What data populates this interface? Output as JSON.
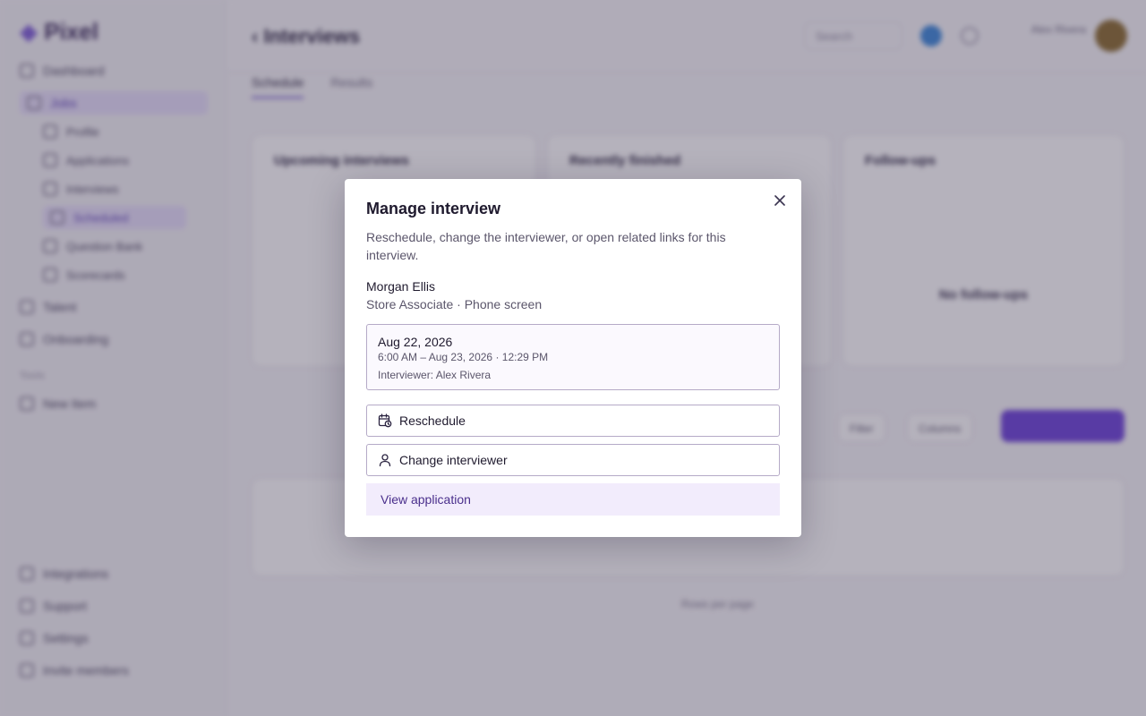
{
  "background": {
    "logo": "Pixel",
    "nav": [
      "Dashboard",
      "Jobs",
      "Profile",
      "Applications",
      "Interviews",
      "Scheduled",
      "Question Bank",
      "Scorecards",
      "Talent",
      "Onboarding"
    ],
    "nav_section": "Tools",
    "nav_extra": "New Item",
    "bottom_nav": [
      "Integrations",
      "Support",
      "Settings",
      "Invite members"
    ],
    "page_title": "Interviews",
    "search": "Search",
    "user": "Alex Rivera",
    "tabs": [
      "Schedule",
      "Results"
    ],
    "cards": [
      "Upcoming interviews",
      "Recently finished",
      "Follow-ups"
    ],
    "empty_title": "No follow-ups",
    "toolbar": [
      "Filter",
      "Columns"
    ],
    "pagination": "Rows per page"
  },
  "modal": {
    "title": "Manage interview",
    "description": "Reschedule, change the interviewer, or open related links for this interview.",
    "candidate_name": "Morgan Ellis",
    "candidate_role": "Store Associate · Phone screen",
    "schedule": {
      "date": "Aug 22, 2026",
      "range": "6:00 AM – Aug 23, 2026 · 12:29 PM",
      "interviewer": "Interviewer: Alex Rivera"
    },
    "actions": {
      "reschedule": "Reschedule",
      "change_interviewer": "Change interviewer",
      "view_application": "View application"
    },
    "close_glyph": "×"
  },
  "colors": {
    "accent": "#6a3fd8",
    "link_bg": "#f2ecfc",
    "link_text": "#4a2f8c",
    "border": "#b5aac7"
  }
}
